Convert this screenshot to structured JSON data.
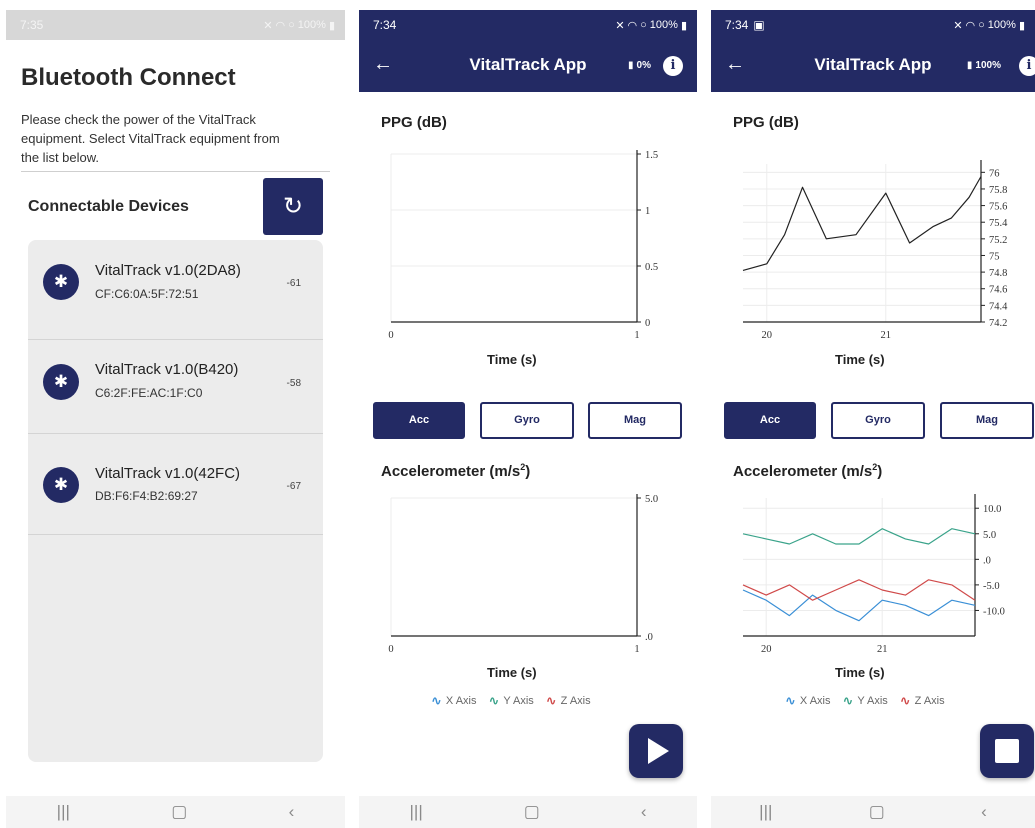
{
  "screen1": {
    "status": {
      "time": "7:35",
      "battery": "100%"
    },
    "title": "Bluetooth Connect",
    "description": "Please check the power of the VitalTrack equipment. Select VitalTrack equipment from the list below.",
    "list_label": "Connectable Devices",
    "devices": [
      {
        "name": "VitalTrack v1.0(2DA8)",
        "mac": "CF:C6:0A:5F:72:51",
        "rssi": "-61"
      },
      {
        "name": "VitalTrack v1.0(B420)",
        "mac": "C6:2F:FE:AC:1F:C0",
        "rssi": "-58"
      },
      {
        "name": "VitalTrack v1.0(42FC)",
        "mac": "DB:F6:F4:B2:69:27",
        "rssi": "-67"
      }
    ]
  },
  "screen2": {
    "status": {
      "time": "7:34",
      "battery": "100%"
    },
    "app_title": "VitalTrack App",
    "device_battery": "0%",
    "ppg_title": "PPG (dB)",
    "ppg_xlabel": "Time (s)",
    "tabs": {
      "acc": "Acc",
      "gyro": "Gyro",
      "mag": "Mag",
      "selected": "Acc"
    },
    "acc_title": "Accelerometer (m/s",
    "acc_title_sup": "2",
    "acc_xlabel": "Time (s)",
    "legend": {
      "x": "X Axis",
      "y": "Y Axis",
      "z": "Z Axis"
    },
    "fab": "play"
  },
  "screen3": {
    "status": {
      "time": "7:34",
      "battery": "100%"
    },
    "app_title": "VitalTrack App",
    "device_battery": "100%",
    "ppg_title": "PPG (dB)",
    "ppg_xlabel": "Time (s)",
    "tabs": {
      "acc": "Acc",
      "gyro": "Gyro",
      "mag": "Mag",
      "selected": "Acc"
    },
    "acc_title": "Accelerometer (m/s",
    "acc_title_sup": "2",
    "acc_xlabel": "Time (s)",
    "legend": {
      "x": "X Axis",
      "y": "Y Axis",
      "z": "Z Axis"
    },
    "fab": "stop"
  },
  "colors": {
    "primary": "#232a64",
    "x_axis": "#3a8fd6",
    "y_axis": "#3aa38a",
    "z_axis": "#d04a4a"
  },
  "chart_data": [
    {
      "id": "ppg_empty",
      "type": "line",
      "title": "PPG (dB)",
      "xlabel": "Time (s)",
      "ylabel": "",
      "xlim": [
        0,
        1
      ],
      "ylim": [
        0,
        1.5
      ],
      "xticks": [
        "0",
        "1"
      ],
      "yticks": [
        "0",
        "0.5",
        "1",
        "1.5"
      ],
      "series": []
    },
    {
      "id": "acc_empty",
      "type": "line",
      "title": "Accelerometer (m/s2)",
      "xlabel": "Time (s)",
      "ylabel": "",
      "xlim": [
        0,
        1
      ],
      "ylim": [
        0,
        5
      ],
      "xticks": [
        "0",
        "1"
      ],
      "yticks": [
        ".0",
        "5.0"
      ],
      "series": []
    },
    {
      "id": "ppg_live",
      "type": "line",
      "title": "PPG (dB)",
      "xlabel": "Time (s)",
      "ylabel": "",
      "xlim": [
        19.8,
        21.8
      ],
      "ylim": [
        74.2,
        76.1
      ],
      "xticks": [
        "20",
        "21"
      ],
      "yticks": [
        "74.2",
        "74.4",
        "74.6",
        "74.8",
        "75",
        "75.2",
        "75.4",
        "75.6",
        "75.8",
        "76"
      ],
      "series": [
        {
          "values": [
            [
              19.8,
              74.82
            ],
            [
              20.0,
              74.9
            ],
            [
              20.15,
              75.25
            ],
            [
              20.3,
              75.82
            ],
            [
              20.5,
              75.2
            ],
            [
              20.75,
              75.25
            ],
            [
              21.0,
              75.75
            ],
            [
              21.2,
              75.15
            ],
            [
              21.4,
              75.35
            ],
            [
              21.55,
              75.45
            ],
            [
              21.7,
              75.7
            ],
            [
              21.8,
              75.95
            ]
          ]
        }
      ]
    },
    {
      "id": "acc_live",
      "type": "line",
      "title": "Accelerometer (m/s2)",
      "xlabel": "Time (s)",
      "ylabel": "",
      "xlim": [
        19.8,
        21.8
      ],
      "ylim": [
        -15,
        12
      ],
      "xticks": [
        "20",
        "21"
      ],
      "yticks": [
        "-10.0",
        "-5.0",
        ".0",
        "5.0",
        "10.0"
      ],
      "series": [
        {
          "name": "X Axis",
          "color": "#3a8fd6",
          "values": [
            [
              19.8,
              -6
            ],
            [
              20.0,
              -8
            ],
            [
              20.2,
              -11
            ],
            [
              20.4,
              -7
            ],
            [
              20.6,
              -10
            ],
            [
              20.8,
              -12
            ],
            [
              21.0,
              -8
            ],
            [
              21.2,
              -9
            ],
            [
              21.4,
              -11
            ],
            [
              21.6,
              -8
            ],
            [
              21.8,
              -9
            ]
          ]
        },
        {
          "name": "Y Axis",
          "color": "#3aa38a",
          "values": [
            [
              19.8,
              5
            ],
            [
              20.0,
              4
            ],
            [
              20.2,
              3
            ],
            [
              20.4,
              5
            ],
            [
              20.6,
              3
            ],
            [
              20.8,
              3
            ],
            [
              21.0,
              6
            ],
            [
              21.2,
              4
            ],
            [
              21.4,
              3
            ],
            [
              21.6,
              6
            ],
            [
              21.8,
              5
            ]
          ]
        },
        {
          "name": "Z Axis",
          "color": "#d04a4a",
          "values": [
            [
              19.8,
              -5
            ],
            [
              20.0,
              -7
            ],
            [
              20.2,
              -5
            ],
            [
              20.4,
              -8
            ],
            [
              20.6,
              -6
            ],
            [
              20.8,
              -4
            ],
            [
              21.0,
              -6
            ],
            [
              21.2,
              -7
            ],
            [
              21.4,
              -4
            ],
            [
              21.6,
              -5
            ],
            [
              21.8,
              -8
            ]
          ]
        }
      ]
    }
  ]
}
